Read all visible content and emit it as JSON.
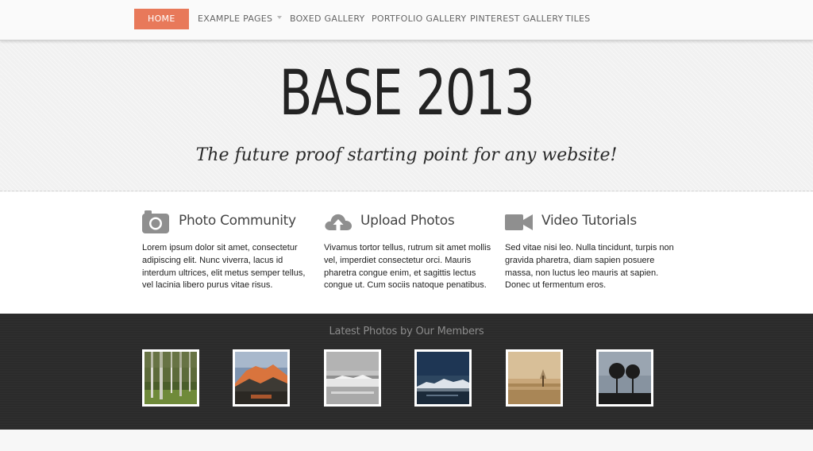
{
  "nav": {
    "items": [
      {
        "label": "Home",
        "active": true
      },
      {
        "label": "Example Pages",
        "has_dropdown": true
      },
      {
        "label": "Boxed Gallery"
      },
      {
        "label": "Portfolio Gallery"
      },
      {
        "label": "Pinterest Gallery"
      },
      {
        "label": "Tiles"
      }
    ],
    "accent_color": "#e8795a"
  },
  "hero": {
    "title": "BASE 2013",
    "subtitle": "The future proof starting point for any website!"
  },
  "features": [
    {
      "icon": "camera-icon",
      "title": "Photo Community",
      "text": "Lorem ipsum dolor sit amet, consectetur adipiscing elit. Nunc viverra, lacus id interdum ultrices, elit metus semper tellus, vel lacinia libero purus vitae risus."
    },
    {
      "icon": "cloud-upload-icon",
      "title": "Upload Photos",
      "text": "Vivamus tortor tellus, rutrum sit amet mollis vel, imperdiet consectetur orci. Mauris pharetra congue enim, et sagittis lectus congue ut. Cum sociis natoque penatibus."
    },
    {
      "icon": "video-camera-icon",
      "title": "Video Tutorials",
      "text": "Sed vitae nisi leo. Nulla tincidunt, turpis non gravida pharetra, diam sapien posuere massa, non luctus leo mauris at sapien. Donec ut fermentum eros."
    }
  ],
  "gallery": {
    "title": "Latest Photos by Our Members",
    "photos": [
      "birch-forest-photo",
      "mountain-sunset-photo",
      "snowy-lake-photo",
      "night-lake-photo",
      "misty-field-photo",
      "silhouette-trees-photo"
    ]
  }
}
